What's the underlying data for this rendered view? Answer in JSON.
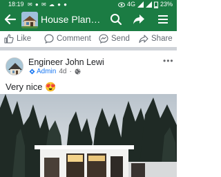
{
  "status_bar": {
    "time": "18:19",
    "network": "4G",
    "battery": "23%"
  },
  "header": {
    "title": "House Plan…",
    "icons": [
      "back-arrow-icon",
      "search-icon",
      "share-icon",
      "menu-icon"
    ]
  },
  "actions": {
    "like": "Like",
    "comment": "Comment",
    "send": "Send",
    "share": "Share"
  },
  "post": {
    "author": "Engineer John Lewi",
    "badge": "Admin",
    "age": "4d",
    "text": "Very nice",
    "emoji": "😍"
  },
  "colors": {
    "brand": "#1b7c43",
    "link": "#1877f2"
  }
}
